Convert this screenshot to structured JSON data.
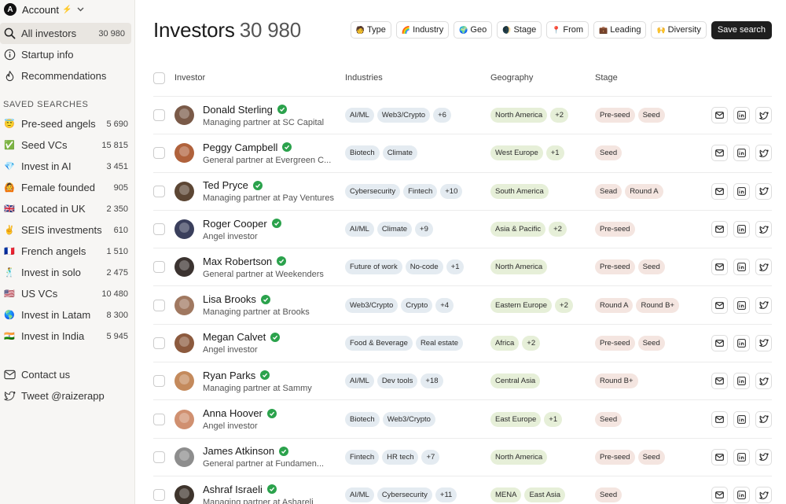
{
  "account": {
    "avatar_letter": "A",
    "label": "Account"
  },
  "nav": [
    {
      "name": "all-investors",
      "icon": "search-icon",
      "label": "All investors",
      "count": "30 980",
      "active": true
    },
    {
      "name": "startup-info",
      "icon": "info-icon",
      "label": "Startup info",
      "count": ""
    },
    {
      "name": "recommendations",
      "icon": "flame-icon",
      "label": "Recommendations",
      "count": ""
    }
  ],
  "saved_title": "SAVED SEARCHES",
  "saved": [
    {
      "emoji": "😇",
      "label": "Pre-seed angels",
      "count": "5 690"
    },
    {
      "emoji": "✅",
      "label": "Seed VCs",
      "count": "15 815"
    },
    {
      "emoji": "💎",
      "label": "Invest in AI",
      "count": "3 451"
    },
    {
      "emoji": "🙆",
      "label": "Female founded",
      "count": "905"
    },
    {
      "emoji": "🇬🇧",
      "label": "Located in UK",
      "count": "2 350"
    },
    {
      "emoji": "✌️",
      "label": "SEIS investments",
      "count": "610"
    },
    {
      "emoji": "🇫🇷",
      "label": "French angels",
      "count": "1 510"
    },
    {
      "emoji": "🕺",
      "label": "Invest in solo",
      "count": "2 475"
    },
    {
      "emoji": "🇺🇸",
      "label": "US VCs",
      "count": "10 480"
    },
    {
      "emoji": "🌎",
      "label": "Invest in Latam",
      "count": "8 300"
    },
    {
      "emoji": "🇮🇳",
      "label": "Invest in India",
      "count": "5 945"
    }
  ],
  "footer": [
    {
      "icon": "mail-icon",
      "label": "Contact us"
    },
    {
      "icon": "twitter-icon",
      "label": "Tweet @raizerapp"
    }
  ],
  "header": {
    "title": "Investors",
    "count": "30 980"
  },
  "filters": [
    {
      "emoji": "🧑",
      "label": "Type"
    },
    {
      "emoji": "🌈",
      "label": "Industry"
    },
    {
      "emoji": "🌍",
      "label": "Geo"
    },
    {
      "emoji": "🌒",
      "label": "Stage"
    },
    {
      "emoji": "📍",
      "label": "From"
    },
    {
      "emoji": "💼",
      "label": "Leading"
    },
    {
      "emoji": "🙌",
      "label": "Diversity"
    }
  ],
  "save_search_label": "Save search",
  "columns": {
    "investor": "Investor",
    "industries": "Industries",
    "geography": "Geography",
    "stage": "Stage"
  },
  "investors": [
    {
      "name": "Donald Sterling",
      "role": "Managing partner at SC Capital",
      "avatar_color": "#7a5a48",
      "industries": [
        "AI/ML",
        "Web3/Crypto",
        "+6"
      ],
      "geography": [
        "North America",
        "+2"
      ],
      "stage": [
        "Pre-seed",
        "Seed"
      ]
    },
    {
      "name": "Peggy Campbell",
      "role": "General partner at Evergreen C...",
      "avatar_color": "#b0623c",
      "industries": [
        "Biotech",
        "Climate"
      ],
      "geography": [
        "West Europe",
        "+1"
      ],
      "stage": [
        "Seed"
      ]
    },
    {
      "name": "Ted Pryce",
      "role": "Managing partner at Pay Ventures",
      "avatar_color": "#5c4634",
      "industries": [
        "Cybersecurity",
        "Fintech",
        "+10"
      ],
      "geography": [
        "South America"
      ],
      "stage": [
        "Sead",
        "Round A"
      ]
    },
    {
      "name": "Roger Cooper",
      "role": "Angel investor",
      "avatar_color": "#3a3f5c",
      "industries": [
        "AI/ML",
        "Climate",
        "+9"
      ],
      "geography": [
        "Asia & Pacific",
        "+2"
      ],
      "stage": [
        "Pre-seed"
      ]
    },
    {
      "name": "Max Robertson",
      "role": "General partner at Weekenders",
      "avatar_color": "#3b3330",
      "industries": [
        "Future of work",
        "No-code",
        "+1"
      ],
      "geography": [
        "North America"
      ],
      "stage": [
        "Pre-seed",
        "Seed"
      ]
    },
    {
      "name": "Lisa Brooks",
      "role": "Managing partner at Brooks",
      "avatar_color": "#a07860",
      "industries": [
        "Web3/Crypto",
        "Crypto",
        "+4"
      ],
      "geography": [
        "Eastern Europe",
        "+2"
      ],
      "stage": [
        "Round A",
        "Round B+"
      ]
    },
    {
      "name": "Megan Calvet",
      "role": "Angel investor",
      "avatar_color": "#8c5a3e",
      "industries": [
        "Food & Beverage",
        "Real estate"
      ],
      "geography": [
        "Africa",
        "+2"
      ],
      "stage": [
        "Pre-seed",
        "Seed"
      ]
    },
    {
      "name": "Ryan Parks",
      "role": "Managing partner at Sammy",
      "avatar_color": "#c48a5c",
      "industries": [
        "AI/ML",
        "Dev tools",
        "+18"
      ],
      "geography": [
        "Central Asia"
      ],
      "stage": [
        "Round B+"
      ]
    },
    {
      "name": "Anna Hoover",
      "role": "Angel investor",
      "avatar_color": "#d09070",
      "industries": [
        "Biotech",
        "Web3/Crypto"
      ],
      "geography": [
        "East Europe",
        "+1"
      ],
      "stage": [
        "Seed"
      ]
    },
    {
      "name": "James Atkinson",
      "role": "General partner at Fundamen...",
      "avatar_color": "#8d8d8d",
      "industries": [
        "Fintech",
        "HR tech",
        "+7"
      ],
      "geography": [
        "North America"
      ],
      "stage": [
        "Pre-seed",
        "Seed"
      ]
    },
    {
      "name": "Ashraf Israeli",
      "role": "Managing partner at Ashareli",
      "avatar_color": "#3e342c",
      "industries": [
        "AI/ML",
        "Cybersecurity",
        "+11"
      ],
      "geography": [
        "MENA",
        "East Asia"
      ],
      "stage": [
        "Seed"
      ]
    }
  ]
}
